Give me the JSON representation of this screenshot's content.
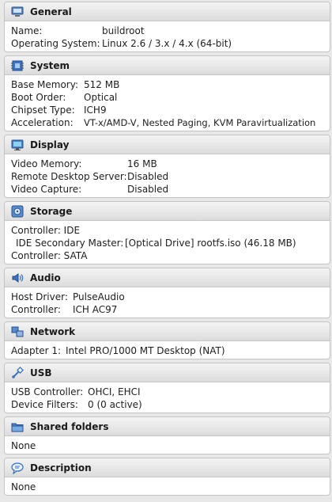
{
  "sections": {
    "general": {
      "title": "General",
      "rows": [
        {
          "key": "Name:",
          "value": "buildroot"
        },
        {
          "key": "Operating System:",
          "value": "Linux 2.6 / 3.x / 4.x (64-bit)"
        }
      ]
    },
    "system": {
      "title": "System",
      "rows": [
        {
          "key": "Base Memory:",
          "value": "512 MB"
        },
        {
          "key": "Boot Order:",
          "value": "Optical"
        },
        {
          "key": "Chipset Type:",
          "value": "ICH9"
        },
        {
          "key": "Acceleration:",
          "value": "VT-x/AMD-V, Nested Paging, KVM Paravirtualization"
        }
      ]
    },
    "display": {
      "title": "Display",
      "rows": [
        {
          "key": "Video Memory:",
          "value": "16 MB"
        },
        {
          "key": "Remote Desktop Server:",
          "value": "Disabled"
        },
        {
          "key": "Video Capture:",
          "value": "Disabled"
        }
      ]
    },
    "storage": {
      "title": "Storage",
      "rows": [
        {
          "key": "Controller: IDE",
          "value": ""
        },
        {
          "key": " IDE Secondary Master:",
          "value": "[Optical Drive] rootfs.iso (46.18 MB)"
        },
        {
          "key": "Controller: SATA",
          "value": ""
        }
      ]
    },
    "audio": {
      "title": "Audio",
      "rows": [
        {
          "key": "Host Driver:",
          "value": "PulseAudio"
        },
        {
          "key": "Controller:",
          "value": "ICH AC97"
        }
      ]
    },
    "network": {
      "title": "Network",
      "rows": [
        {
          "key": "Adapter 1:",
          "value": "Intel PRO/1000 MT Desktop (NAT)"
        }
      ]
    },
    "usb": {
      "title": "USB",
      "rows": [
        {
          "key": "USB Controller:",
          "value": "OHCI, EHCI"
        },
        {
          "key": "Device Filters:",
          "value": "0 (0 active)"
        }
      ]
    },
    "shared_folders": {
      "title": "Shared folders",
      "rows": [
        {
          "key": "None",
          "value": ""
        }
      ]
    },
    "description": {
      "title": "Description",
      "rows": [
        {
          "key": "None",
          "value": ""
        }
      ]
    }
  }
}
